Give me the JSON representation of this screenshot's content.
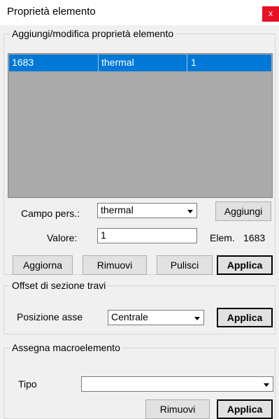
{
  "window": {
    "title": "Proprietà elemento",
    "close_label": "x"
  },
  "group_properties": {
    "title": "Aggiungi/modifica proprietà elemento",
    "list_rows": [
      {
        "id": "1683",
        "field": "thermal",
        "value": "1"
      }
    ],
    "custom_field_label": "Campo pers.:",
    "custom_field_value": "thermal",
    "add_button": "Aggiungi",
    "value_label": "Valore:",
    "value_input": "1",
    "elem_label": "Elem.",
    "elem_value": "1683",
    "update_button": "Aggiorna",
    "remove_button": "Rimuovi",
    "clear_button": "Pulisci",
    "apply_button": "Applica"
  },
  "group_offset": {
    "title": "Offset di sezione travi",
    "axis_label": "Posizione asse",
    "axis_value": "Centrale",
    "apply_button": "Applica"
  },
  "group_macro": {
    "title": "Assegna macroelemento",
    "type_label": "Tipo",
    "type_value": "",
    "remove_button": "Rimuovi",
    "apply_button": "Applica"
  },
  "colors": {
    "selection": "#0078d7",
    "close": "#e81123",
    "dialog_bg": "#f0f0f0",
    "list_bg": "#aaaaaa"
  }
}
